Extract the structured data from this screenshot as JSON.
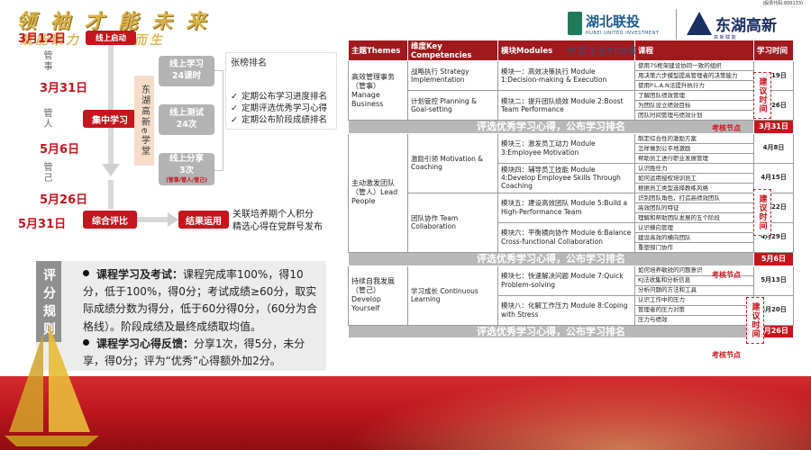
{
  "header": {
    "slogan": "领 袖 才 能 未 来",
    "slogan_sub": "赋能聚力 通向上而生",
    "logo_hubei": {
      "name": "湖北联投",
      "sub": "HUBEI UNITED INVESTMENT"
    },
    "logo_east": {
      "name": "东湖高新",
      "code": "(股票代码:600133)",
      "sub": "高 新 赋 能"
    },
    "watermark": "中国企业500强"
  },
  "flow": {
    "dates": [
      "3月12日",
      "3月31日",
      "5月6日",
      "5月26日",
      "5月31日"
    ],
    "stages": [
      "管事",
      "管人",
      "管己"
    ],
    "launch": "线上启动",
    "central": "集中学习",
    "compare": "综合评比",
    "result": "结果运用",
    "result_note": "关联培养期个人积分\n精选心得在党群号发布",
    "online_boxes": [
      {
        "line1": "线上学习",
        "line2": "24课时"
      },
      {
        "line1": "线上测试",
        "line2": "24次"
      },
      {
        "line1": "线上分享",
        "line2": "3次",
        "line3": "(管事/管人/管己)"
      }
    ],
    "classroom": "东湖高新e学堂",
    "ranking": {
      "title": "张榜排名",
      "items": [
        "定期公布学习进度排名",
        "定期评选优秀学习心得",
        "定期公布阶段成绩排名"
      ]
    }
  },
  "scoring": {
    "tab": "评分规则",
    "rule1_title": "课程学习及考试：",
    "rule1_text": "课程完成率100%，得10分，低于100%，得0分；考试成绩≥60分，取实际成绩分数为得分，低于60分得0分，（60分为合格线）。阶段成绩及最终成绩取均值。",
    "rule2_title": "课程学习心得反馈：",
    "rule2_text": "分享1次，得5分，未分享，得0分；评为“优秀”心得额外加2分。"
  },
  "table": {
    "headers": [
      "主题Themes",
      "维度Key Competencies",
      "模块Modules",
      "课程",
      "学习时间"
    ],
    "band_label": "评选优秀学习心得，公布学习排名",
    "node_label": "考核节点",
    "suggest_label": "建议时间",
    "band_dates": [
      "3月31日",
      "5月6日",
      "5月26日"
    ],
    "sections": [
      {
        "theme": "高效管理事务（管事）Manage Business",
        "dimensions": [
          {
            "name": "战略执行 Strategy Implementation",
            "module": "模块一：高效决策执行 Module 1:Decision-making & Execution",
            "courses": [
              "使用7S框架建设协同一致的组织",
              "用决策六步模型提高管理者的决策能力",
              "使用P.L.A.N法提升执行力"
            ],
            "date": "3月19日"
          },
          {
            "name": "计划管控 Planning & Goal-setting",
            "module": "模块二：提升团队绩效 Module 2:Boost Team Performance",
            "courses": [
              "了解团队绩效管理",
              "为团队设立绩效目标",
              "团队时间管理与绩效计划"
            ],
            "date": "3月26日"
          }
        ]
      },
      {
        "theme": "主动激发团队（管人）Lead People",
        "dimensions": [
          {
            "name": "激励引领 Motivation & Coaching",
            "modules": [
              {
                "module": "模块三：激发员工动力 Module 3:Employee Motivation",
                "courses": [
                  "制定综合性的激励方案",
                  "怎样做到公平地激励",
                  "帮助员工进行职业发展管理"
                ],
                "date": "4月8日"
              },
              {
                "module": "模块四：辅导员工技能 Module 4:Develop Employee Skills Through Coaching",
                "courses": [
                  "认识胜任力",
                  "如何运用授权培训员工",
                  "根据员工类型选择教练风格"
                ],
                "date": "4月15日"
              }
            ]
          },
          {
            "name": "团队协作 Team Collaboration",
            "modules": [
              {
                "module": "模块五：建设高效团队 Module 5:Build a High-Performance Team",
                "courses": [
                  "识别团队角色，打造高绩效团队",
                  "高效团队的特征",
                  "理解和帮助团队发展的五个阶段"
                ],
                "date": "4月22日"
              },
              {
                "module": "模块六：平衡横向协作 Module 6:Balance Cross-functional Collaboration",
                "courses": [
                  "认识横向管理",
                  "建设高效的横向团队",
                  "重塑部门协作"
                ],
                "date": "4月29日"
              }
            ]
          }
        ]
      },
      {
        "theme": "持续自我发展（管己）Develop Yourself",
        "dimensions": [
          {
            "name": "学习成长 Continuous Learning",
            "modules": [
              {
                "module": "模块七：快速解决问题 Module 7:Quick Problem-solving",
                "courses": [
                  "如何培养敏锐的问题意识",
                  "KJ法收集和分析信息",
                  "分析问题的方法和工具"
                ],
                "date": "5月13日"
              },
              {
                "module": "模块八：化解工作压力 Module 8:Coping with Stress",
                "courses": [
                  "认识工作中的压力",
                  "管理者的压力对策",
                  "压力与绩效"
                ],
                "date": "5月20日"
              }
            ]
          }
        ]
      }
    ]
  },
  "colors": {
    "brand_red": "#c4161c",
    "band_grey": "#b8b8b8",
    "gold": "#d8b24a"
  }
}
